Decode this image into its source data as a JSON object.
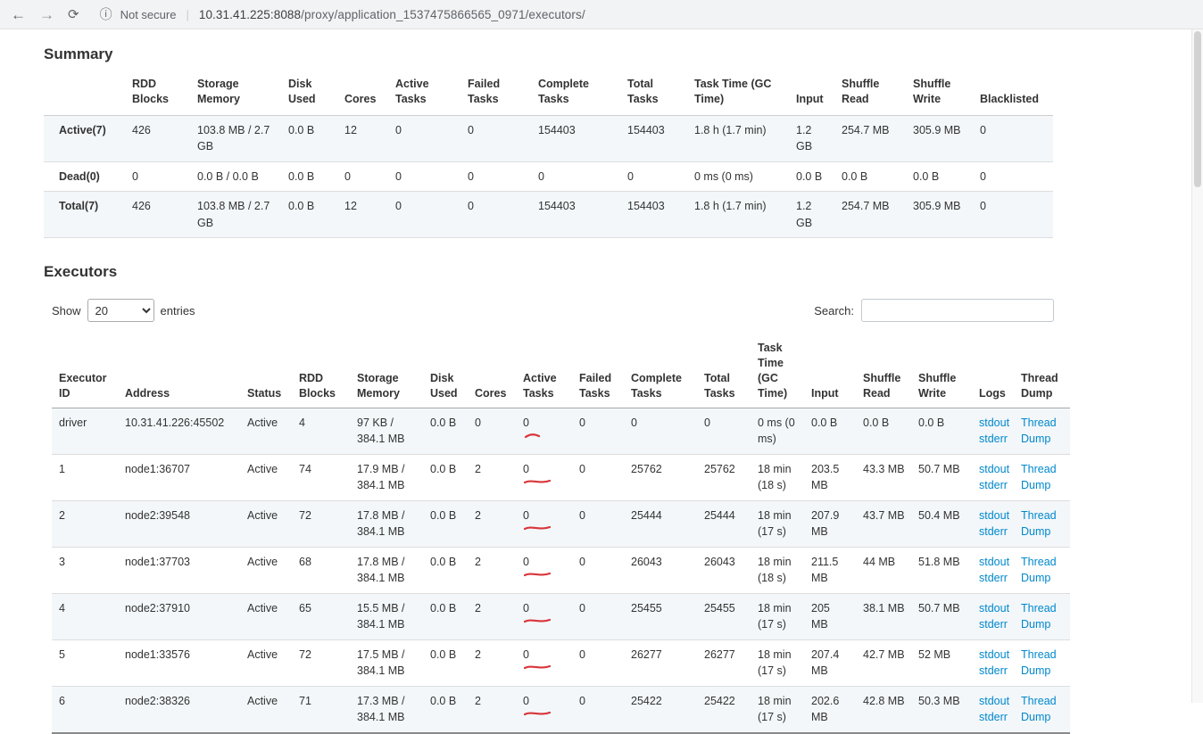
{
  "browser": {
    "icons": {
      "back": "←",
      "forward": "→",
      "reload": "⟳",
      "info": "ⓘ"
    },
    "security_label": "Not secure",
    "url_divider": "|",
    "url_host": "10.31.41.225:8088",
    "url_path": "/proxy/application_1537475866565_0971/executors/"
  },
  "annotation": {
    "description": "hand-drawn red underline marks under the Active Tasks zeros",
    "color": "#d9353a"
  },
  "colors": {
    "link": "#0088cc",
    "stripe": "#f3f7fa"
  },
  "summary": {
    "title": "Summary",
    "columns": [
      "",
      "RDD Blocks",
      "Storage Memory",
      "Disk Used",
      "Cores",
      "Active Tasks",
      "Failed Tasks",
      "Complete Tasks",
      "Total Tasks",
      "Task Time (GC Time)",
      "Input",
      "Shuffle Read",
      "Shuffle Write",
      "Blacklisted"
    ],
    "rows": [
      {
        "label": "Active(7)",
        "values": [
          "426",
          "103.8 MB / 2.7 GB",
          "0.0 B",
          "12",
          "0",
          "0",
          "154403",
          "154403",
          "1.8 h (1.7 min)",
          "1.2 GB",
          "254.7 MB",
          "305.9 MB",
          "0"
        ]
      },
      {
        "label": "Dead(0)",
        "values": [
          "0",
          "0.0 B / 0.0 B",
          "0.0 B",
          "0",
          "0",
          "0",
          "0",
          "0",
          "0 ms (0 ms)",
          "0.0 B",
          "0.0 B",
          "0.0 B",
          "0"
        ]
      },
      {
        "label": "Total(7)",
        "values": [
          "426",
          "103.8 MB / 2.7 GB",
          "0.0 B",
          "12",
          "0",
          "0",
          "154403",
          "154403",
          "1.8 h (1.7 min)",
          "1.2 GB",
          "254.7 MB",
          "305.9 MB",
          "0"
        ]
      }
    ]
  },
  "executors": {
    "title": "Executors",
    "show_label": "Show",
    "page_size": "20",
    "entries_label": "entries",
    "search_label": "Search:",
    "search_value": "",
    "columns": [
      "Executor ID",
      "Address",
      "Status",
      "RDD Blocks",
      "Storage Memory",
      "Disk Used",
      "Cores",
      "Active Tasks",
      "Failed Tasks",
      "Complete Tasks",
      "Total Tasks",
      "Task Time (GC Time)",
      "Input",
      "Shuffle Read",
      "Shuffle Write",
      "Logs",
      "Thread Dump"
    ],
    "logs_links": [
      "stdout",
      "stderr"
    ],
    "thread_dump_label": "Thread Dump",
    "rows": [
      {
        "id": "driver",
        "address": "10.31.41.226:45502",
        "status": "Active",
        "rdd_blocks": "4",
        "storage_memory": "97 KB / 384.1 MB",
        "disk_used": "0.0 B",
        "cores": "0",
        "active_tasks": "0",
        "failed_tasks": "0",
        "complete_tasks": "0",
        "total_tasks": "0",
        "task_time": "0 ms (0 ms)",
        "input": "0.0 B",
        "shuffle_read": "0.0 B",
        "shuffle_write": "0.0 B"
      },
      {
        "id": "1",
        "address": "node1:36707",
        "status": "Active",
        "rdd_blocks": "74",
        "storage_memory": "17.9 MB / 384.1 MB",
        "disk_used": "0.0 B",
        "cores": "2",
        "active_tasks": "0",
        "failed_tasks": "0",
        "complete_tasks": "25762",
        "total_tasks": "25762",
        "task_time": "18 min (18 s)",
        "input": "203.5 MB",
        "shuffle_read": "43.3 MB",
        "shuffle_write": "50.7 MB"
      },
      {
        "id": "2",
        "address": "node2:39548",
        "status": "Active",
        "rdd_blocks": "72",
        "storage_memory": "17.8 MB / 384.1 MB",
        "disk_used": "0.0 B",
        "cores": "2",
        "active_tasks": "0",
        "failed_tasks": "0",
        "complete_tasks": "25444",
        "total_tasks": "25444",
        "task_time": "18 min (17 s)",
        "input": "207.9 MB",
        "shuffle_read": "43.7 MB",
        "shuffle_write": "50.4 MB"
      },
      {
        "id": "3",
        "address": "node1:37703",
        "status": "Active",
        "rdd_blocks": "68",
        "storage_memory": "17.8 MB / 384.1 MB",
        "disk_used": "0.0 B",
        "cores": "2",
        "active_tasks": "0",
        "failed_tasks": "0",
        "complete_tasks": "26043",
        "total_tasks": "26043",
        "task_time": "18 min (18 s)",
        "input": "211.5 MB",
        "shuffle_read": "44 MB",
        "shuffle_write": "51.8 MB"
      },
      {
        "id": "4",
        "address": "node2:37910",
        "status": "Active",
        "rdd_blocks": "65",
        "storage_memory": "15.5 MB / 384.1 MB",
        "disk_used": "0.0 B",
        "cores": "2",
        "active_tasks": "0",
        "failed_tasks": "0",
        "complete_tasks": "25455",
        "total_tasks": "25455",
        "task_time": "18 min (17 s)",
        "input": "205 MB",
        "shuffle_read": "38.1 MB",
        "shuffle_write": "50.7 MB"
      },
      {
        "id": "5",
        "address": "node1:33576",
        "status": "Active",
        "rdd_blocks": "72",
        "storage_memory": "17.5 MB / 384.1 MB",
        "disk_used": "0.0 B",
        "cores": "2",
        "active_tasks": "0",
        "failed_tasks": "0",
        "complete_tasks": "26277",
        "total_tasks": "26277",
        "task_time": "18 min (17 s)",
        "input": "207.4 MB",
        "shuffle_read": "42.7 MB",
        "shuffle_write": "52 MB"
      },
      {
        "id": "6",
        "address": "node2:38326",
        "status": "Active",
        "rdd_blocks": "71",
        "storage_memory": "17.3 MB / 384.1 MB",
        "disk_used": "0.0 B",
        "cores": "2",
        "active_tasks": "0",
        "failed_tasks": "0",
        "complete_tasks": "25422",
        "total_tasks": "25422",
        "task_time": "18 min (17 s)",
        "input": "202.6 MB",
        "shuffle_read": "42.8 MB",
        "shuffle_write": "50.3 MB"
      }
    ]
  }
}
